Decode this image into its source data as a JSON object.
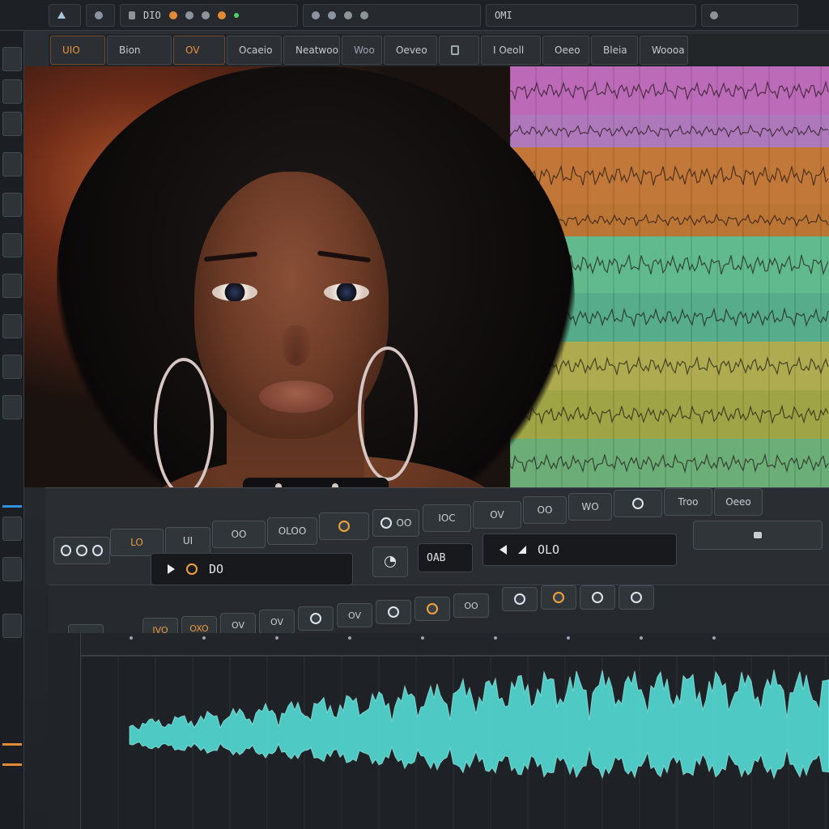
{
  "topbar": {
    "group1": "",
    "group2_label": "DIO",
    "group3_label": "",
    "time_display": "OMI"
  },
  "toolbar": {
    "tabs": [
      {
        "label": "UIO",
        "style": "orange"
      },
      {
        "label": "Bion",
        "style": "normal"
      },
      {
        "label": "OV",
        "style": "orange"
      },
      {
        "label": "Ocaeio",
        "style": "normal"
      },
      {
        "label": "Neatwoo",
        "style": "normal"
      },
      {
        "label": "Woo",
        "style": "dim"
      },
      {
        "label": "Oeveo",
        "style": "normal"
      },
      {
        "label": "",
        "style": "dim"
      },
      {
        "label": "I Oeoll",
        "style": "normal"
      },
      {
        "label": "Oeeo",
        "style": "normal"
      },
      {
        "label": "Bleia",
        "style": "normal"
      },
      {
        "label": "Woooa",
        "style": "normal"
      }
    ]
  },
  "transport": {
    "chips": [
      {
        "label": "LO",
        "accent": ""
      },
      {
        "label": "UI",
        "accent": ""
      },
      {
        "label": "OO",
        "accent": ""
      },
      {
        "label": "OLOO",
        "accent": ""
      },
      {
        "label": "OO",
        "accent": ""
      },
      {
        "label": "OO",
        "accent": ""
      },
      {
        "label": "IOC",
        "accent": "I"
      },
      {
        "label": "OV",
        "accent": ""
      },
      {
        "label": "OO",
        "accent": ""
      },
      {
        "label": "WO",
        "accent": ""
      },
      {
        "label": "Troo",
        "accent": ""
      },
      {
        "label": "Oeeo",
        "accent": ""
      }
    ],
    "display_main": "DO",
    "display_secondary": "OLO",
    "small_display": "OAB"
  },
  "editbar": {
    "chips": [
      "OO",
      "IVO",
      "OXO",
      "OV",
      "OV",
      "OV",
      "OV",
      "OO",
      "OO"
    ]
  },
  "colors": {
    "waveform": "#58e6e0",
    "accent_orange": "#e9923c",
    "lane_pink": "#d97ad6",
    "lane_orange": "#e08a3f",
    "lane_green": "#6fd7a2",
    "lane_yellow": "#c9c65a"
  },
  "icons": [
    "play-icon",
    "record-icon",
    "loop-icon",
    "knob-icon",
    "speaker-icon"
  ]
}
